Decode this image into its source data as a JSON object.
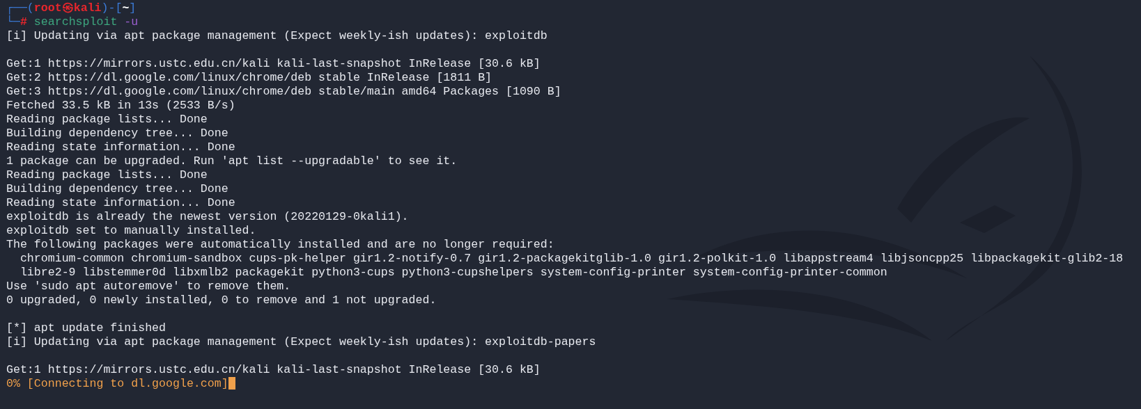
{
  "terminal": {
    "prompt": {
      "segments": [
        {
          "kind": "frame",
          "text": "┌──("
        },
        {
          "kind": "user",
          "text": "root㉿kali"
        },
        {
          "kind": "frame",
          "text": ")-["
        },
        {
          "kind": "cwd",
          "text": "~"
        },
        {
          "kind": "frame",
          "text": "]"
        },
        {
          "kind": "newline"
        },
        {
          "kind": "frame",
          "text": "└─"
        },
        {
          "kind": "sign",
          "text": "#"
        },
        {
          "kind": "command",
          "text": "searchsploit"
        },
        {
          "kind": "argument",
          "text": "-u"
        }
      ]
    },
    "lines": [
      {
        "kind": "output",
        "text": "[i] Updating via apt package management (Expect weekly-ish updates): exploitdb"
      },
      {
        "kind": "blank"
      },
      {
        "kind": "output",
        "text": "Get:1 https://mirrors.ustc.edu.cn/kali kali-last-snapshot InRelease [30.6 kB]"
      },
      {
        "kind": "output",
        "text": "Get:2 https://dl.google.com/linux/chrome/deb stable InRelease [1811 B]"
      },
      {
        "kind": "output",
        "text": "Get:3 https://dl.google.com/linux/chrome/deb stable/main amd64 Packages [1090 B]"
      },
      {
        "kind": "output",
        "text": "Fetched 33.5 kB in 13s (2533 B/s)"
      },
      {
        "kind": "output",
        "text": "Reading package lists... Done"
      },
      {
        "kind": "output",
        "text": "Building dependency tree... Done"
      },
      {
        "kind": "output",
        "text": "Reading state information... Done"
      },
      {
        "kind": "output",
        "text": "1 package can be upgraded. Run 'apt list --upgradable' to see it."
      },
      {
        "kind": "output",
        "text": "Reading package lists... Done"
      },
      {
        "kind": "output",
        "text": "Building dependency tree... Done"
      },
      {
        "kind": "output",
        "text": "Reading state information... Done"
      },
      {
        "kind": "output",
        "text": "exploitdb is already the newest version (20220129-0kali1)."
      },
      {
        "kind": "output",
        "text": "exploitdb set to manually installed."
      },
      {
        "kind": "output",
        "text": "The following packages were automatically installed and are no longer required:"
      },
      {
        "kind": "output",
        "text": "  chromium-common chromium-sandbox cups-pk-helper gir1.2-notify-0.7 gir1.2-packagekitglib-1.0 gir1.2-polkit-1.0 libappstream4 libjsoncpp25 libpackagekit-glib2-18"
      },
      {
        "kind": "output",
        "text": "  libre2-9 libstemmer0d libxmlb2 packagekit python3-cups python3-cupshelpers system-config-printer system-config-printer-common"
      },
      {
        "kind": "output",
        "text": "Use 'sudo apt autoremove' to remove them."
      },
      {
        "kind": "output",
        "text": "0 upgraded, 0 newly installed, 0 to remove and 1 not upgraded."
      },
      {
        "kind": "blank"
      },
      {
        "kind": "output",
        "text": "[*] apt update finished"
      },
      {
        "kind": "output",
        "text": "[i] Updating via apt package management (Expect weekly-ish updates): exploitdb-papers"
      },
      {
        "kind": "blank"
      },
      {
        "kind": "output",
        "text": "Get:1 https://mirrors.ustc.edu.cn/kali kali-last-snapshot InRelease [30.6 kB]"
      },
      {
        "kind": "progress",
        "text": "0% [Connecting to dl.google.com]",
        "cursor": true
      }
    ]
  }
}
